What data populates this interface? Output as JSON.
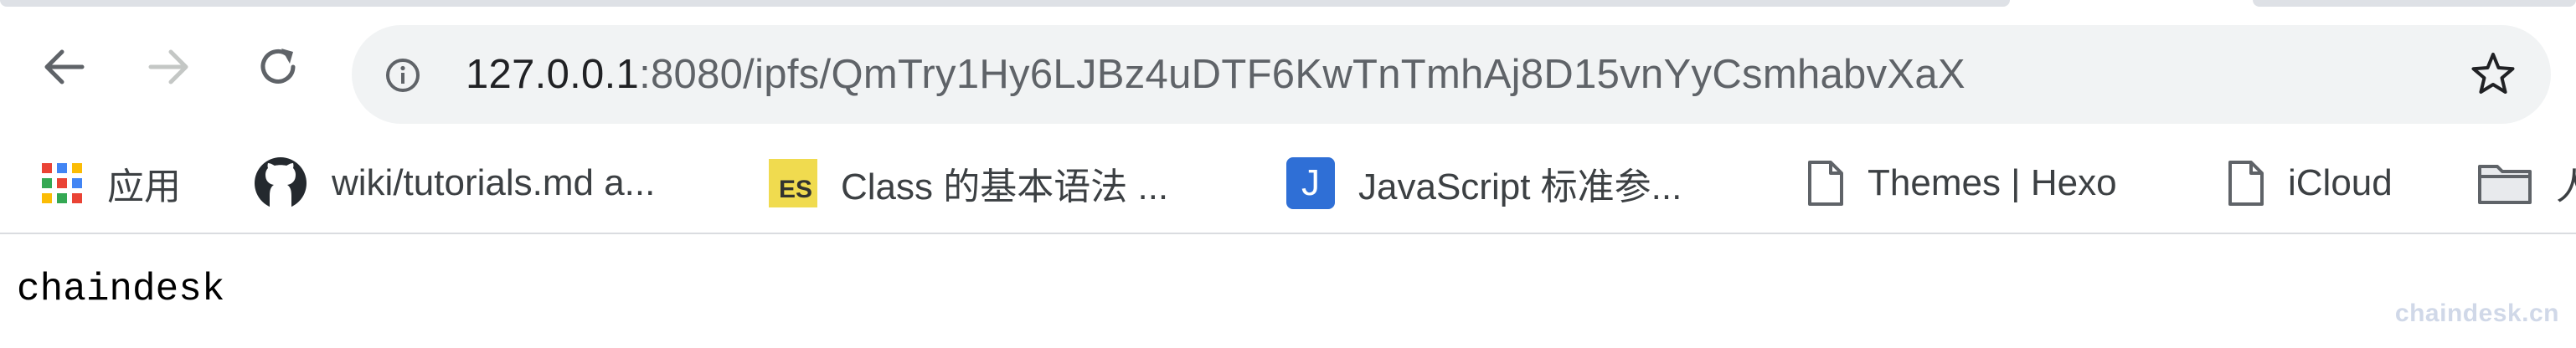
{
  "toolbar": {
    "back_icon": "arrow-left-icon",
    "forward_icon": "arrow-right-icon",
    "reload_icon": "reload-icon",
    "address": {
      "host": "127.0.0.1",
      "rest": ":8080/ipfs/QmTry1Hy6LJBz4uDTF6KwTnTmhAj8D15vnYyCsmhabvXaX"
    },
    "bookmark_star_icon": "star-icon"
  },
  "bookmarks": [
    {
      "label": "应用",
      "icon": "apps-grid-icon"
    },
    {
      "label": "wiki/tutorials.md a...",
      "icon": "github-icon"
    },
    {
      "label": "Class 的基本语法 ...",
      "icon": "es-icon",
      "badge": "ES"
    },
    {
      "label": "JavaScript 标准参...",
      "icon": "j-icon",
      "badge": "J"
    },
    {
      "label": "Themes | Hexo",
      "icon": "page-icon"
    },
    {
      "label": "iCloud",
      "icon": "page-icon"
    },
    {
      "label": "人",
      "icon": "folder-icon"
    }
  ],
  "page": {
    "body_text": "chaindesk",
    "watermark": "chaindesk.cn"
  },
  "colors": {
    "omnibox_bg": "#f1f3f4",
    "host_text": "#202124",
    "path_text": "#5f6368",
    "es_badge": "#f0db4f",
    "j_badge": "#2f6fd6"
  }
}
